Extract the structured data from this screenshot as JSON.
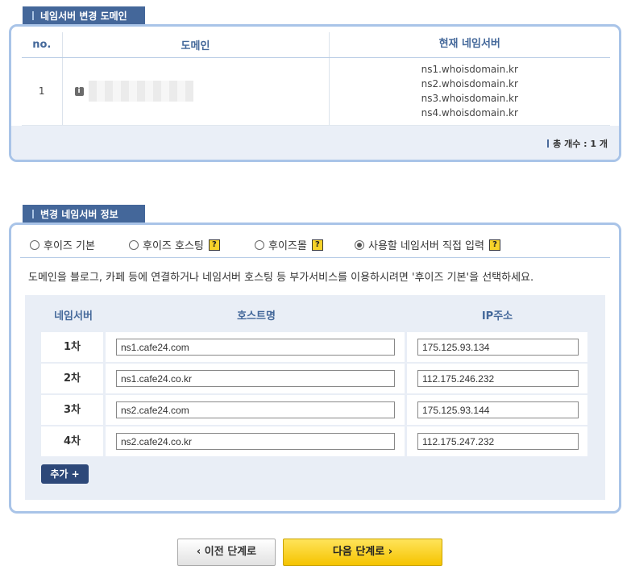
{
  "section1": {
    "title": "네임서버 변경 도메인",
    "columns": {
      "no": "no.",
      "domain": "도메인",
      "nameserver": "현재 네임서버"
    },
    "rows": [
      {
        "no": "1",
        "domain_icon": "info-icon",
        "nameservers": [
          "ns1.whoisdomain.kr",
          "ns2.whoisdomain.kr",
          "ns3.whoisdomain.kr",
          "ns4.whoisdomain.kr"
        ]
      }
    ],
    "total": "총 개수 : 1 개"
  },
  "section2": {
    "title": "변경 네임서버 정보",
    "options": [
      {
        "label": "후이즈 기본",
        "checked": false,
        "help": false
      },
      {
        "label": "후이즈 호스팅",
        "checked": false,
        "help": true
      },
      {
        "label": "후이즈몰",
        "checked": false,
        "help": true
      },
      {
        "label": "사용할 네임서버 직접 입력",
        "checked": true,
        "help": true
      }
    ],
    "help_glyph": "?",
    "description": "도메인을 블로그, 카페 등에 연결하거나 네임서버 호스팅 등 부가서비스를 이용하시려면 '후이즈 기본'을 선택하세요.",
    "table": {
      "headers": {
        "ns": "네임서버",
        "host": "호스트명",
        "ip": "IP주소"
      },
      "rows": [
        {
          "label": "1차",
          "host": "ns1.cafe24.com",
          "ip": "175.125.93.134"
        },
        {
          "label": "2차",
          "host": "ns1.cafe24.co.kr",
          "ip": "112.175.246.232"
        },
        {
          "label": "3차",
          "host": "ns2.cafe24.com",
          "ip": "175.125.93.144"
        },
        {
          "label": "4차",
          "host": "ns2.cafe24.co.kr",
          "ip": "112.175.247.232"
        }
      ]
    },
    "add_button": "추가 +"
  },
  "buttons": {
    "prev": "‹ 이전 단계로",
    "next": "다음 단계로 ›"
  }
}
